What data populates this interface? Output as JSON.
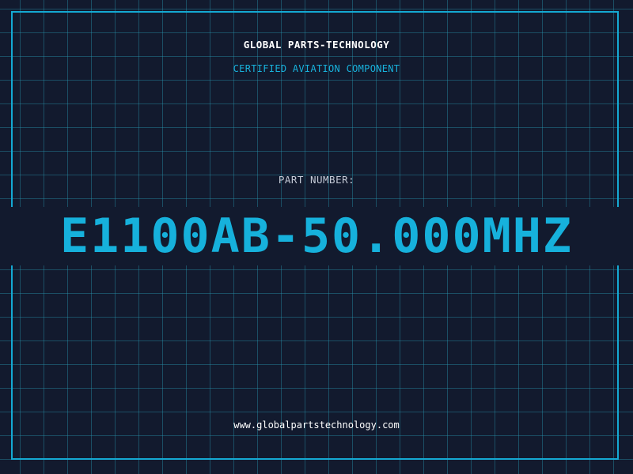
{
  "header": {
    "company": "GLOBAL PARTS-TECHNOLOGY",
    "tagline": "CERTIFIED AVIATION COMPONENT"
  },
  "part": {
    "label": "PART NUMBER:",
    "number": "E1100AB-50.000MHZ"
  },
  "footer": {
    "website": "www.globalpartstechnology.com"
  },
  "colors": {
    "background": "#121a2e",
    "accent": "#16b1dc",
    "grid": "#28a0b4",
    "text": "#ffffff"
  }
}
